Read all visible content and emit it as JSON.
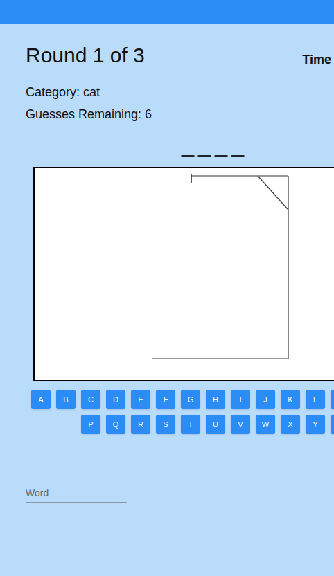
{
  "header": {
    "round": "Round 1 of 3",
    "time_label": "Time"
  },
  "category": "Category: cat",
  "guesses": "Guesses Remaining: 6",
  "slots": [
    {
      "revealed": false
    },
    {
      "revealed": false
    },
    {
      "revealed": false
    },
    {
      "revealed": false
    }
  ],
  "keyboard": {
    "rows": [
      [
        {
          "label": "A",
          "disabled": false
        },
        {
          "label": "B",
          "disabled": false
        },
        {
          "label": "C",
          "disabled": false
        },
        {
          "label": "D",
          "disabled": false
        },
        {
          "label": "E",
          "disabled": false
        },
        {
          "label": "F",
          "disabled": false
        },
        {
          "label": "G",
          "disabled": false
        },
        {
          "label": "H",
          "disabled": false
        },
        {
          "label": "I",
          "disabled": false
        },
        {
          "label": "J",
          "disabled": false
        },
        {
          "label": "K",
          "disabled": false
        },
        {
          "label": "L",
          "disabled": false
        },
        {
          "label": "",
          "disabled": false
        }
      ],
      [
        {
          "label": "P",
          "disabled": false
        },
        {
          "label": "Q",
          "disabled": false
        },
        {
          "label": "R",
          "disabled": false
        },
        {
          "label": "S",
          "disabled": false
        },
        {
          "label": "T",
          "disabled": false
        },
        {
          "label": "U",
          "disabled": false
        },
        {
          "label": "V",
          "disabled": false
        },
        {
          "label": "W",
          "disabled": false
        },
        {
          "label": "X",
          "disabled": false
        },
        {
          "label": "Y",
          "disabled": false
        },
        {
          "label": "",
          "disabled": false
        }
      ]
    ]
  },
  "word_input": {
    "placeholder": "Word"
  }
}
